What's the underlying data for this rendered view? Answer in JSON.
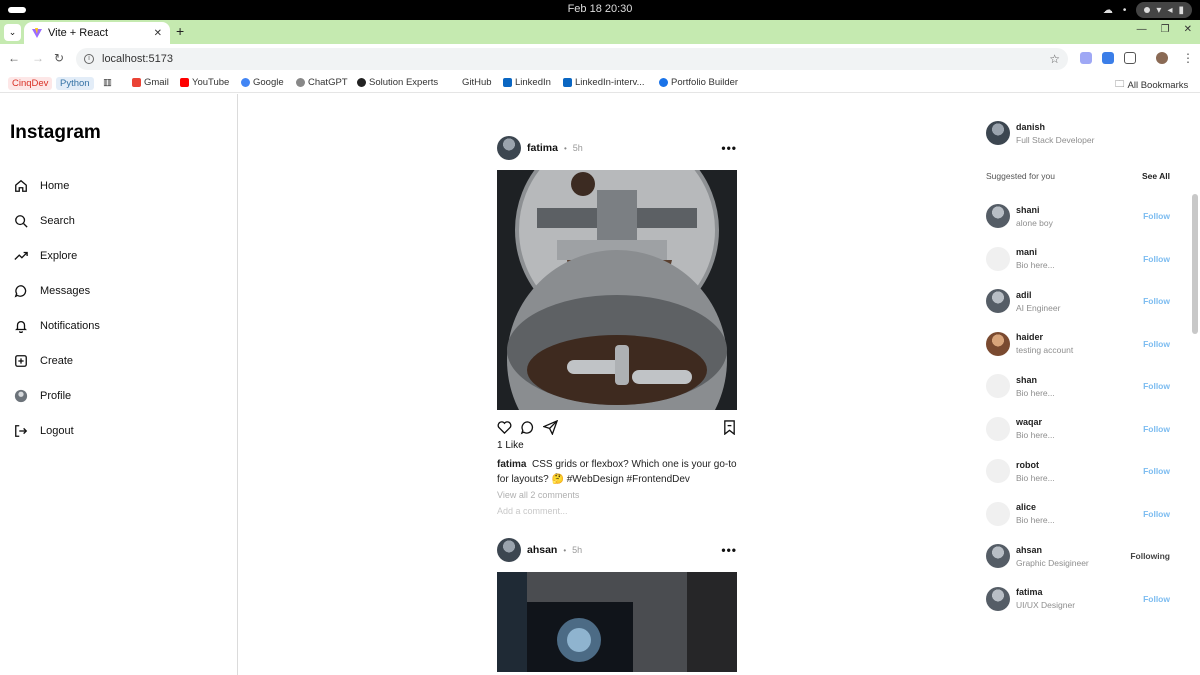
{
  "os": {
    "clock": "Feb 18  20:30"
  },
  "browser": {
    "tab_title": "Vite + React",
    "url": "localhost:5173",
    "bookmarks": [
      {
        "label": "CinqDev",
        "color": "#e8453c"
      },
      {
        "label": "Python",
        "color": "#3572a5"
      },
      {
        "label": "Gmail",
        "color": "#ea4335"
      },
      {
        "label": "YouTube",
        "color": "#ff0000"
      },
      {
        "label": "Google",
        "color": "#4285f4"
      },
      {
        "label": "ChatGPT",
        "color": "#555555"
      },
      {
        "label": "Solution Experts",
        "color": "#222222"
      },
      {
        "label": "GitHub",
        "color": "#222222"
      },
      {
        "label": "LinkedIn",
        "color": "#0a66c2"
      },
      {
        "label": "LinkedIn-interv...",
        "color": "#0a66c2"
      },
      {
        "label": "Portfolio Builder",
        "color": "#1a73e8"
      }
    ],
    "all_bookmarks": "All Bookmarks"
  },
  "app": {
    "logo": "Instagram",
    "nav": [
      {
        "label": "Home",
        "icon": "home-icon"
      },
      {
        "label": "Search",
        "icon": "search-icon"
      },
      {
        "label": "Explore",
        "icon": "trending-icon"
      },
      {
        "label": "Messages",
        "icon": "message-icon"
      },
      {
        "label": "Notifications",
        "icon": "bell-icon"
      },
      {
        "label": "Create",
        "icon": "plus-square-icon"
      },
      {
        "label": "Profile",
        "icon": "avatar-icon"
      },
      {
        "label": "Logout",
        "icon": "logout-icon"
      }
    ]
  },
  "posts": [
    {
      "user": "fatima",
      "time": "5h",
      "likes": "1 Like",
      "caption_user": "fatima",
      "caption": "CSS grids or flexbox? Which one is your go-to for layouts? 🤔 #WebDesign #FrontendDev",
      "view_comments": "View all 2 comments",
      "add_comment": "Add a comment..."
    },
    {
      "user": "ahsan",
      "time": "5h"
    }
  ],
  "right_panel": {
    "me": {
      "username": "danish",
      "bio": "Full Stack Developer"
    },
    "suggested_label": "Suggested for you",
    "see_all": "See All",
    "suggestions": [
      {
        "username": "shani",
        "bio": "alone boy",
        "action": "Follow",
        "photo": true
      },
      {
        "username": "mani",
        "bio": "Bio here...",
        "action": "Follow",
        "photo": false
      },
      {
        "username": "adil",
        "bio": "AI Engineer",
        "action": "Follow",
        "photo": true
      },
      {
        "username": "haider",
        "bio": "testing account",
        "action": "Follow",
        "photo": true
      },
      {
        "username": "shan",
        "bio": "Bio here...",
        "action": "Follow",
        "photo": false
      },
      {
        "username": "waqar",
        "bio": "Bio here...",
        "action": "Follow",
        "photo": false
      },
      {
        "username": "robot",
        "bio": "Bio here...",
        "action": "Follow",
        "photo": false
      },
      {
        "username": "alice",
        "bio": "Bio here...",
        "action": "Follow",
        "photo": false
      },
      {
        "username": "ahsan",
        "bio": "Graphic Desigineer",
        "action": "Following",
        "photo": true
      },
      {
        "username": "fatima",
        "bio": "UI/UX Designer",
        "action": "Follow",
        "photo": true
      }
    ]
  }
}
